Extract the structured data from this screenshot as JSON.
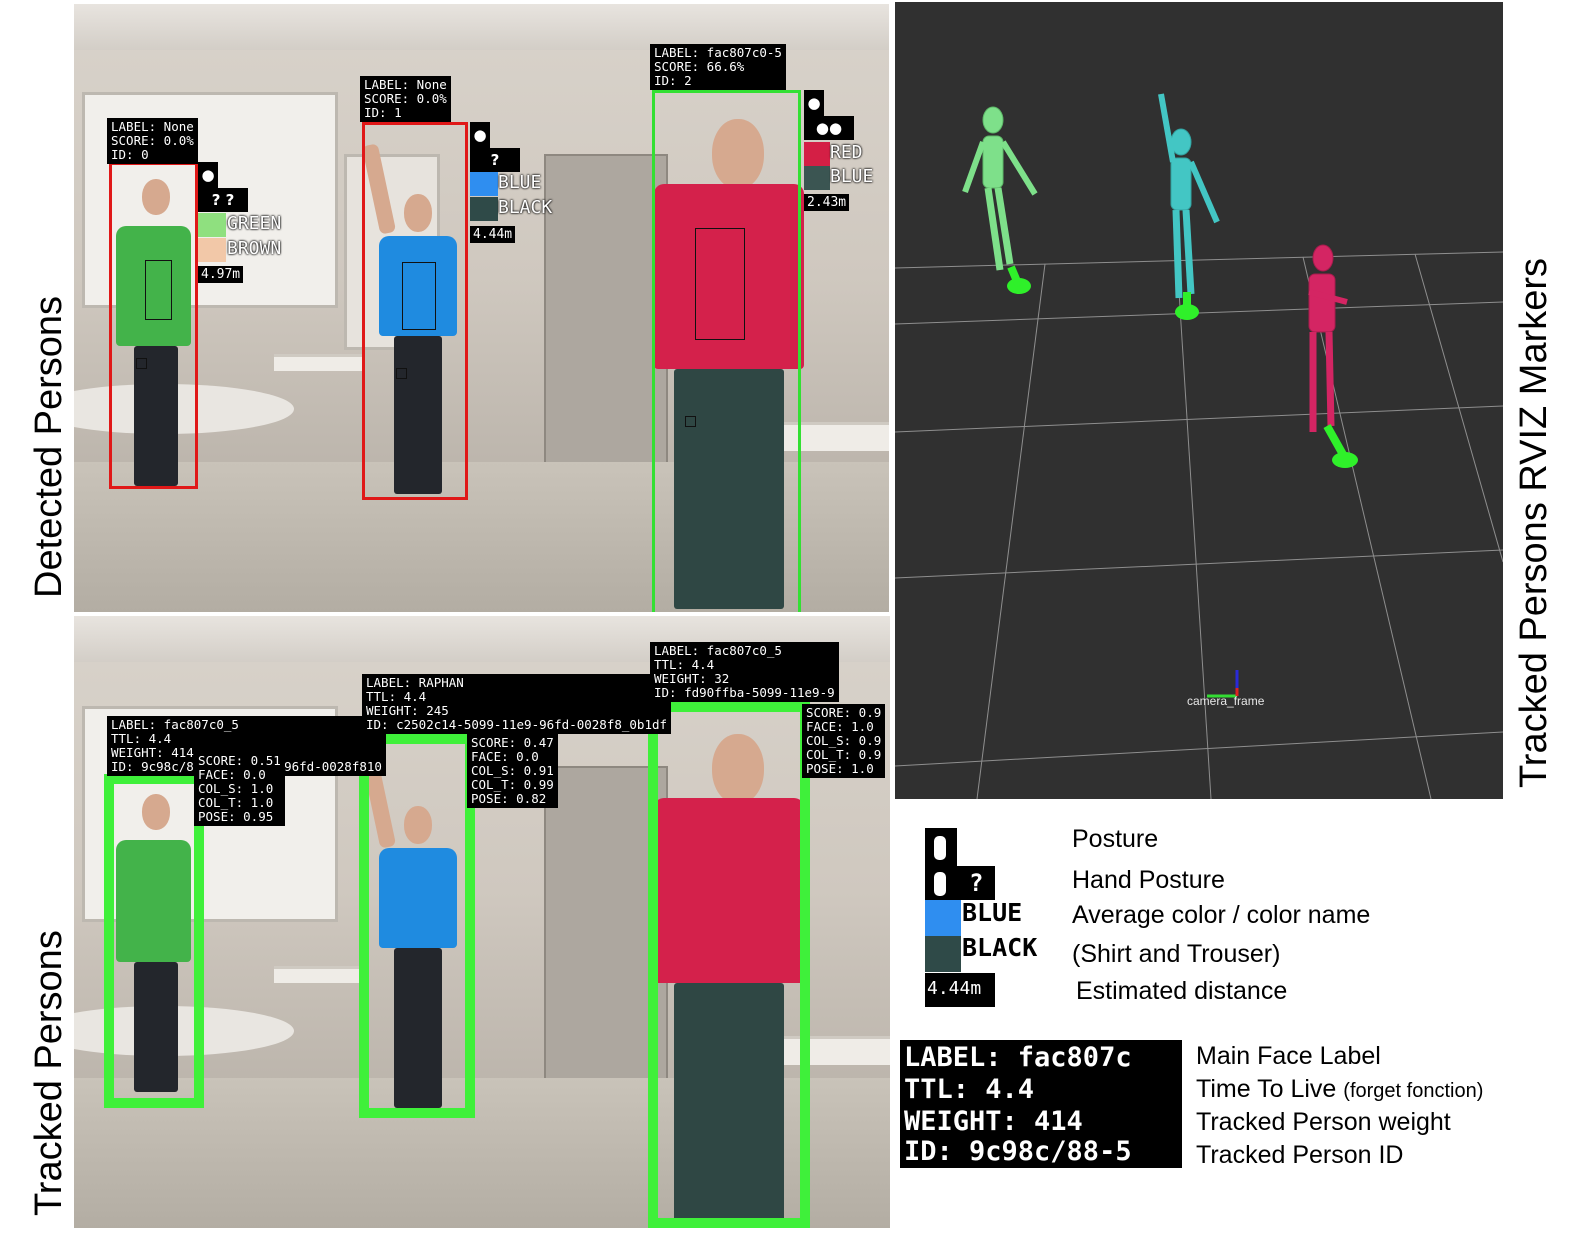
{
  "side_titles": {
    "detected": "Detected Persons",
    "tracked": "Tracked Persons",
    "rviz": "Tracked Persons RVIZ Markers"
  },
  "detected": {
    "p1": {
      "label": "LABEL: None",
      "score": "SCORE: 0.0%",
      "id": "ID: 0",
      "hand": "? ?",
      "shirt": "GREEN",
      "trouser": "BROWN",
      "distance": "4.97m",
      "shirt_color": "#8fe07f",
      "trouser_color": "#f2c8a8"
    },
    "p2": {
      "label": "LABEL: None",
      "score": "SCORE: 0.0%",
      "id": "ID: 1",
      "hand": "?",
      "shirt": "BLUE",
      "trouser": "BLACK",
      "distance": "4.44m",
      "shirt_color": "#2f8ef0",
      "trouser_color": "#2f4a48"
    },
    "p3": {
      "label": "LABEL: fac807c0-5",
      "score": "SCORE: 66.6%",
      "id": "ID: 2",
      "shirt": "RED",
      "trouser": "BLUE",
      "distance": "2.43m",
      "shirt_color": "#d41f45",
      "trouser_color": "#3b5552"
    }
  },
  "tracked": {
    "p1": {
      "label": "LABEL: fac807c0_5",
      "ttl": "TTL: 4.4",
      "weight": "WEIGHT: 414",
      "id": "ID: 9c98c/88-5099-11e9-96fd-0028f810",
      "score": "SCORE: 0.51",
      "face": "FACE: 0.0",
      "col_s": "COL_S: 1.0",
      "col_t": "COL_T: 1.0",
      "pose": "POSE: 0.95"
    },
    "p2": {
      "label": "LABEL: RAPHAN",
      "ttl": "TTL: 4.4",
      "weight": "WEIGHT: 245",
      "id": "ID: c2502c14-5099-11e9-96fd-0028f8_0b1df",
      "score": "SCORE: 0.47",
      "face": "FACE: 0.0",
      "col_s": "COL_S: 0.91",
      "col_t": "COL_T: 0.99",
      "pose": "POSE: 0.82"
    },
    "p3": {
      "label": "LABEL: fac807c0_5",
      "ttl": "TTL: 4.4",
      "weight": "WEIGHT: 32",
      "id": "ID: fd90ffba-5099-11e9-9",
      "score": "SCORE: 0.9",
      "face": "FACE: 1.0",
      "col_s": "COL_S: 0.9",
      "col_t": "COL_T: 0.9",
      "pose": "POSE: 1.0"
    }
  },
  "rviz": {
    "frame_label": "camera_frame",
    "figure_colors": [
      "#7ee08a",
      "#43c6c4",
      "#d42563"
    ],
    "foot_color": "#2ff02a"
  },
  "legend_top": {
    "hand_icon": "?",
    "shirt": "BLUE",
    "trouser": "BLACK",
    "distance": "4.44m",
    "shirt_color": "#2f8ef0",
    "trouser_color": "#2f4a48",
    "items": {
      "posture": "Posture",
      "hand_posture": "Hand Posture",
      "avg_color": "Average color / color name",
      "shirt_trouser": "(Shirt and Trouser)",
      "distance": "Estimated distance"
    }
  },
  "legend_bottom": {
    "tag_label": "LABEL: fac807c",
    "tag_ttl": "TTL: 4.4",
    "tag_weight": "WEIGHT: 414",
    "tag_id": "ID: 9c98c/88-5",
    "main_face_label": "Main Face Label",
    "time_to_live": "Time To Live",
    "forget_note": "(forget fonction)",
    "weight": "Tracked Person weight",
    "id": "Tracked Person ID"
  }
}
